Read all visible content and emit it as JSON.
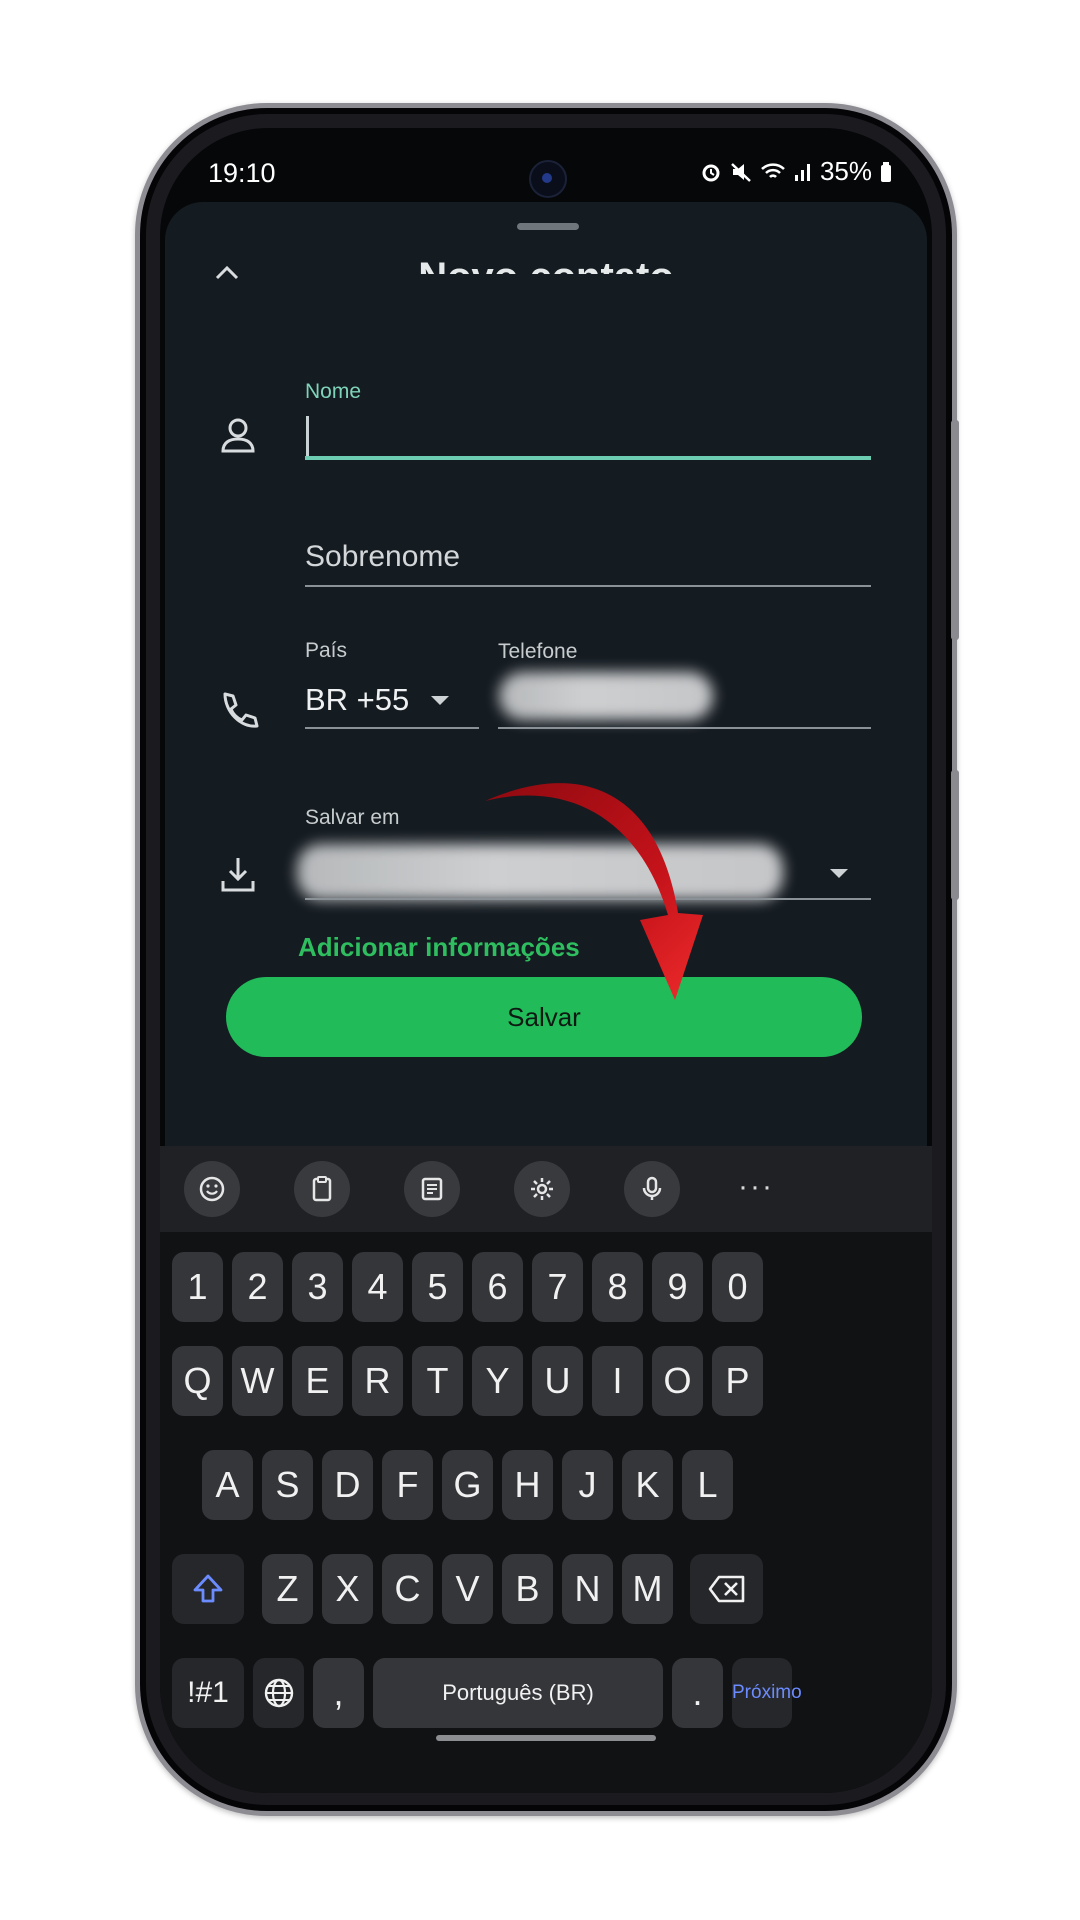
{
  "status_bar": {
    "time": "19:10",
    "battery": "35%"
  },
  "header": {
    "title": "Novo contato"
  },
  "form": {
    "nome_label": "Nome",
    "nome_value": "",
    "sobrenome_placeholder": "Sobrenome",
    "pais_label": "País",
    "pais_value": "BR +55",
    "telefone_label": "Telefone",
    "salvar_em_label": "Salvar em",
    "add_info_link": "Adicionar informações",
    "save_button": "Salvar"
  },
  "keyboard": {
    "number_row": [
      "1",
      "2",
      "3",
      "4",
      "5",
      "6",
      "7",
      "8",
      "9",
      "0"
    ],
    "row1": [
      "Q",
      "W",
      "E",
      "R",
      "T",
      "Y",
      "U",
      "I",
      "O",
      "P"
    ],
    "row2": [
      "A",
      "S",
      "D",
      "F",
      "G",
      "H",
      "J",
      "K",
      "L"
    ],
    "row3": [
      "Z",
      "X",
      "C",
      "V",
      "B",
      "N",
      "M"
    ],
    "symbols_key": "!#1",
    "comma_key": ",",
    "space_key": "Português (BR)",
    "period_key": ".",
    "next_key": "Próximo",
    "toolbar_more": "···"
  },
  "colors": {
    "accent_green": "#22bb5a",
    "field_active": "#6ccdb2",
    "link_green": "#2fbe5f",
    "annotation_arrow": "#c4121a"
  },
  "icons": [
    "person-icon",
    "phone-icon",
    "download-icon",
    "chevron-up-icon",
    "emoji-icon",
    "clipboard-icon",
    "text-edit-icon",
    "settings-icon",
    "microphone-icon",
    "shift-icon",
    "backspace-icon",
    "globe-icon"
  ]
}
